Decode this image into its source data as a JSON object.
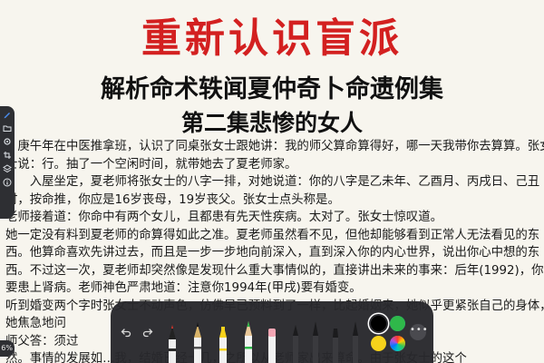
{
  "document": {
    "title": "重新认识盲派",
    "subtitle": "解析命术轶闻夏仲奇卜命遗例集",
    "episode": "第二集悲惨的女人",
    "paragraphs": [
      "　庚午年在中医推拿班，认识了同桌张女士跟她讲：我的师父算命算得好，哪一天我带你去算算。张女士说：行。抽了一个空闲时间，就带她去了夏老师家。",
      "　　入屋坐定，夏老师将张女士的八字一排，对她说道：你的八字是乙未年、乙酉月、丙戌日、己丑时，按命推，你应是16岁丧母，19岁丧父。张女士点头称是。",
      "老师接着道：你命中有两个女儿，且都患有先天性疾病。太对了。张女士惊叹道。",
      "她一定没有料到夏老师的命算得如此之准。夏老师虽然看不见，但他却能够看到正常人无法看见的东西。他算命喜欢先讲过去，而且是一步一步地向前深入，直到深入你的内心世界，说出你心中想的东西。不过这一次，夏老师却突然像是发现什么重大事情似的，直接讲出未来的事来：后年(1992)，你要患上肾病。老师神色严肃地道：注意你1994年(甲戌)要有婚变。",
      "听到婚变两个字时张女士不动声色，仿佛早已预料到了一样，比起婚姻来，她似乎更紧张自己的身体，她焦急地问",
      "师父答：须过",
      "然。事情的发展如…我，结婚已经十几，之所以从老师家出来算命。由于张女士的这个"
    ]
  },
  "left_rail": {
    "icons": [
      "pen-tool-icon",
      "folder-icon",
      "gear-icon",
      "crop-icon",
      "layers-icon",
      "info-icon"
    ],
    "zoom_label": "6%"
  },
  "toolbar": {
    "undo_icon": "undo-icon",
    "redo_icon": "redo-icon",
    "more_label": "•••",
    "tools": [
      "fountain-pen-tool",
      "ink-pen-tool",
      "highlighter-tool",
      "pencil-tool",
      "eraser-tool",
      "marker-tool",
      "brush-tool",
      "calligraphy-tool",
      "crayon-tool"
    ],
    "colors": {
      "black": "#000000",
      "blue": "#1e63e9",
      "green": "#2fb84a",
      "yellow": "#f6d21b",
      "red": "#e8332a",
      "multicolor": "color-wheel"
    },
    "selected_color": "black"
  }
}
